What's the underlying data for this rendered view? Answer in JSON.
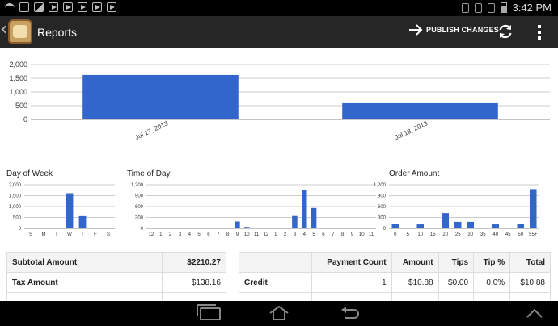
{
  "status_bar": {
    "time": "3:42 PM"
  },
  "action_bar": {
    "title": "Reports",
    "publish_label": "PUBLISH CHANGES",
    "icons": [
      "back-chevron-icon",
      "app-logo",
      "arrow-right-icon",
      "refresh-icon",
      "overflow-menu-icon"
    ]
  },
  "colors": {
    "bar": "#3366cc",
    "actionbar": "#262626",
    "grid": "#cccccc"
  },
  "chart_data": [
    {
      "type": "bar",
      "title": "",
      "categories": [
        "Jul 17, 2013",
        "Jul 18, 2013"
      ],
      "values": [
        1620,
        590
      ],
      "ylim": [
        0,
        2000
      ],
      "yticks": [
        "2,000",
        "1,500",
        "1,000",
        "500",
        "0"
      ],
      "grid": true
    },
    {
      "type": "bar",
      "title": "Day of Week",
      "categories": [
        "S",
        "M",
        "T",
        "W",
        "T",
        "F",
        "S"
      ],
      "values": [
        0,
        0,
        0,
        1610,
        560,
        0,
        0
      ],
      "ylim": [
        0,
        2000
      ],
      "yticks": [
        "2,000",
        "1,500",
        "1,000",
        "500",
        "0"
      ],
      "grid": true
    },
    {
      "type": "bar",
      "title": "Time of Day",
      "categories": [
        "12",
        "1",
        "2",
        "3",
        "4",
        "5",
        "6",
        "7",
        "8",
        "9",
        "10",
        "11",
        "12",
        "1",
        "2",
        "3",
        "4",
        "5",
        "6",
        "7",
        "8",
        "9",
        "10",
        "11"
      ],
      "values": [
        0,
        0,
        0,
        0,
        0,
        0,
        0,
        0,
        0,
        190,
        40,
        0,
        0,
        0,
        0,
        340,
        1060,
        560,
        0,
        0,
        0,
        0,
        0,
        0
      ],
      "ylim": [
        0,
        1200
      ],
      "yticks": [
        "1,200",
        "900",
        "600",
        "300",
        "0"
      ],
      "grid": true
    },
    {
      "type": "bar",
      "title": "Order Amount",
      "categories": [
        "0",
        "5",
        "10",
        "15",
        "20",
        "25",
        "30",
        "35",
        "40",
        "45",
        "50",
        "55+"
      ],
      "values": [
        120,
        0,
        110,
        0,
        420,
        180,
        180,
        0,
        110,
        0,
        120,
        1080
      ],
      "ylim": [
        0,
        1200
      ],
      "yticks": [
        "1,200",
        "900",
        "600",
        "300",
        "0"
      ],
      "grid": true
    }
  ],
  "summary_table": {
    "rows": [
      {
        "label": "Subtotal Amount",
        "value": "$2210.27"
      },
      {
        "label": "Tax Amount",
        "value": "$138.16"
      }
    ]
  },
  "payment_table": {
    "headers": [
      "",
      "Payment Count",
      "Amount",
      "Tips",
      "Tip %",
      "Total"
    ],
    "rows": [
      [
        "Credit",
        "1",
        "$10.88",
        "$0.00",
        "0.0%",
        "$10.88"
      ]
    ]
  },
  "nav_bar": {
    "icons": [
      "recent-apps-icon",
      "home-icon",
      "back-icon",
      "chevron-up-icon"
    ]
  }
}
